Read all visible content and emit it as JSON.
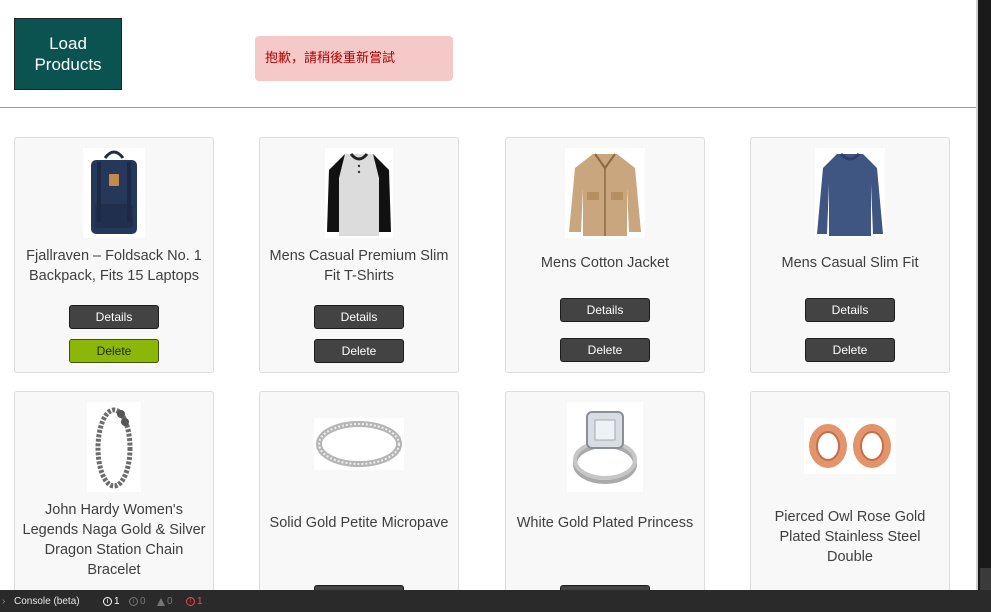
{
  "toolbar": {
    "load_label": "Load Products"
  },
  "error_message": "抱歉，請稍後重新嘗試",
  "products": [
    {
      "title": "Fjallraven – Foldsack No. 1 Backpack, Fits 15 Laptops",
      "details_label": "Details",
      "delete_label": "Delete",
      "image": "backpack-image"
    },
    {
      "title": "Mens Casual Premium Slim Fit T-Shirts",
      "details_label": "Details",
      "delete_label": "Delete",
      "image": "tshirt-image"
    },
    {
      "title": "Mens Cotton Jacket",
      "details_label": "Details",
      "delete_label": "Delete",
      "image": "jacket-image"
    },
    {
      "title": "Mens Casual Slim Fit",
      "details_label": "Details",
      "delete_label": "Delete",
      "image": "longsleeve-image"
    },
    {
      "title": "John Hardy Women's Legends Naga Gold & Silver Dragon Station Chain Bracelet",
      "image": "bracelet-image"
    },
    {
      "title": "Solid Gold Petite Micropave",
      "image": "ring-image"
    },
    {
      "title": "White Gold Plated Princess",
      "image": "engagement-ring-image"
    },
    {
      "title": "Pierced Owl Rose Gold Plated Stainless Steel Double",
      "image": "ear-plugs-image"
    }
  ],
  "console": {
    "label": "Console (beta)",
    "info_count": "1",
    "verbose_count": "0",
    "warning_count": "0",
    "error_count": "1"
  },
  "colors": {
    "load_button": "#0b5351",
    "error_bg": "#f6c9c9",
    "error_text": "#b00000",
    "button_dark": "#434343",
    "button_hover_green": "#8db60a"
  }
}
